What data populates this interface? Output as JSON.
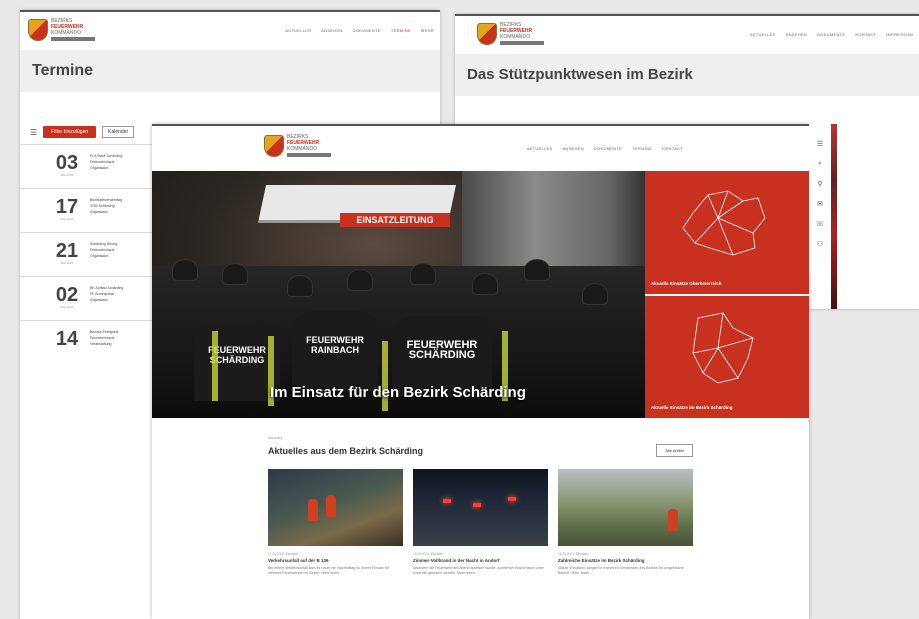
{
  "logo": {
    "line1": "BEZIRKS",
    "line2": "FEUERWEHR",
    "line3": "KOMMANDO"
  },
  "left_window": {
    "nav": [
      "AKTUELLES",
      "ANSEHEN",
      "DOKUMENTE",
      "TERMINE",
      "MEHR"
    ],
    "band_title": "Termine",
    "toolbar": {
      "menu_icon": "menu-icon",
      "btn_red": "Filter hinzufügen",
      "btn_outline": "Kalender"
    },
    "events": [
      {
        "day": "03",
        "month": "Mai 2024",
        "title": "FLA Stadt Schärding",
        "line2": "Feuerwehrhaus",
        "line3": "Organisator"
      },
      {
        "day": "17",
        "month": "Mai 2024",
        "title": "Bezirksfeuerwehrtag",
        "line2": "4780 Schärding",
        "line3": "Organisator"
      },
      {
        "day": "21",
        "month": "Mai 2024",
        "title": "Schärding Übung",
        "line2": "Feuerwehrhaus",
        "line3": "Organisator"
      },
      {
        "day": "02",
        "month": "Mai 2024",
        "title": "BK Aufbau Schärding",
        "line2": "FF Brunnenthal",
        "line3": "Organisator"
      },
      {
        "day": "14",
        "month": "",
        "title": "Bezirks-Festspiele",
        "line2": "Feuerwehrhaus",
        "line3": "Veranstaltung"
      }
    ]
  },
  "right_window": {
    "nav": [
      "AKTUELLES",
      "ANSEHEN",
      "DOKUMENTE",
      "KONTAKT",
      "IMPRESSUM"
    ],
    "band_title": "Das Stützpunktwesen im Bezirk"
  },
  "main_window": {
    "nav": [
      "AKTUELLES",
      "ANSEHEN",
      "DOKUMENTE",
      "TERMINE",
      "KONTAKT"
    ],
    "hero": {
      "headline": "Im Einsatz für den Bezirk Schärding",
      "tent_label": "EINSATZLEITUNG",
      "jackets": [
        "FEUERWEHR\nSCHÄRDING",
        "FEUERWEHR\nRAINBACH",
        "FEUERWEHR\nSCHÄRDING"
      ]
    },
    "panels": [
      {
        "label": "Aktuelle Einsätze Oberösterreich"
      },
      {
        "label": "Aktuelle Einsätze im Bezirk Schärding"
      }
    ],
    "news": {
      "subtitle": "Aktuelles",
      "title": "Aktuelles aus dem Bezirk Schärding",
      "all_button": "Alle Artikel",
      "cards": [
        {
          "date": "17.05.2024, Einsätze",
          "title": "Verkehrsunfall auf der B 136",
          "text": "Bei einem Verkehrsunfall kam es heute am Nachmittag zu einem Einsatz für mehrere Feuerwehren im Bezirk. Mehr lesen..."
        },
        {
          "date": "16.05.2024, Einsätze",
          "title": "Zimmer-Vollbrand in der Nacht in Andorf",
          "text": "Nachdem die Feuerwehr am Abend alarmiert wurde, konnte der Brand rasch unter Kontrolle gebracht werden. Mehr lesen..."
        },
        {
          "date": "15.05.2024, Einsätze",
          "title": "Zahlreiche Einsätze im Bezirk Schärding",
          "text": "Starke Windböen sorgten in mehreren Gemeinden des Bezirks für umgestürzte Bäume. Mehr lesen..."
        }
      ]
    },
    "rail_icons": [
      "menu-icon",
      "search-icon",
      "location-icon",
      "mail-icon",
      "phone-icon",
      "user-icon"
    ]
  }
}
